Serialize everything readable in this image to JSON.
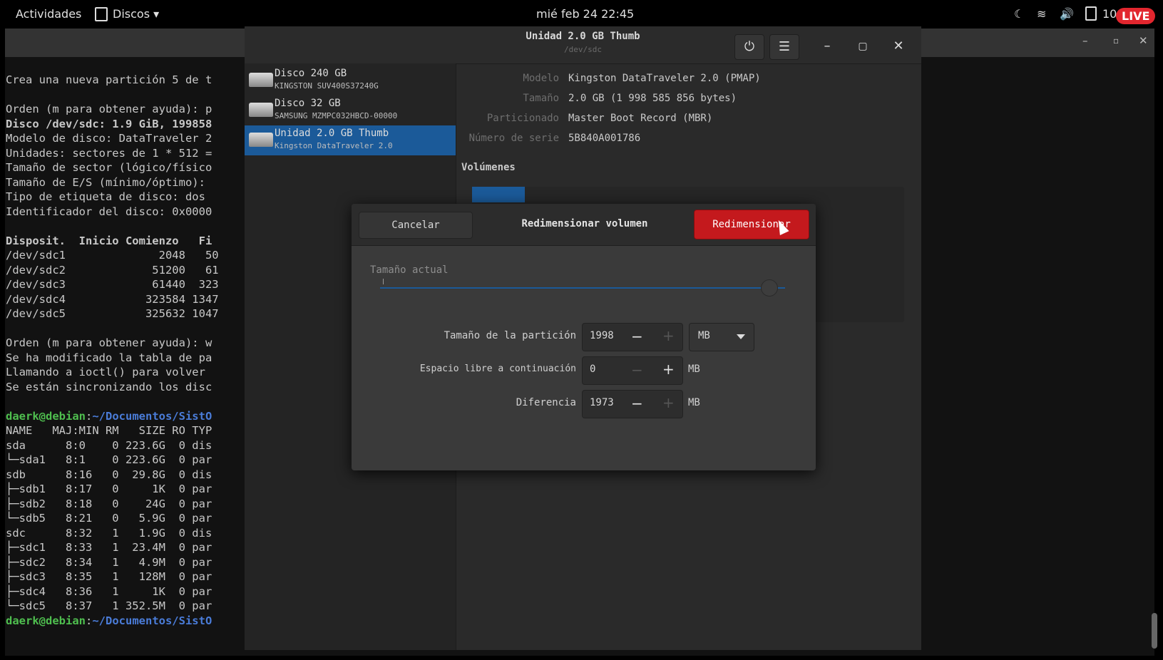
{
  "topbar": {
    "activities": "Actividades",
    "app_menu": "Discos ▾",
    "clock": "mié feb 24  22:45",
    "battery": "10",
    "live_badge": "LIVE"
  },
  "terminal": {
    "lines": [
      {
        "text": "Crea una nueva partición 5 de t",
        "style": ""
      },
      {
        "text": "",
        "style": ""
      },
      {
        "text": "Orden (m para obtener ayuda): p",
        "style": ""
      },
      {
        "text": "Disco /dev/sdc: 1.9 GiB, 199858",
        "style": "bold"
      },
      {
        "text": "Modelo de disco: DataTraveler 2",
        "style": ""
      },
      {
        "text": "Unidades: sectores de 1 * 512 =",
        "style": ""
      },
      {
        "text": "Tamaño de sector (lógico/físico",
        "style": ""
      },
      {
        "text": "Tamaño de E/S (mínimo/óptimo):",
        "style": ""
      },
      {
        "text": "Tipo de etiqueta de disco: dos",
        "style": ""
      },
      {
        "text": "Identificador del disco: 0x0000",
        "style": ""
      },
      {
        "text": "",
        "style": ""
      },
      {
        "text": "Disposit.  Inicio Comienzo   Fi",
        "style": "bold"
      },
      {
        "text": "/dev/sdc1              2048   50",
        "style": ""
      },
      {
        "text": "/dev/sdc2             51200   61",
        "style": ""
      },
      {
        "text": "/dev/sdc3             61440  323",
        "style": ""
      },
      {
        "text": "/dev/sdc4            323584 1347",
        "style": ""
      },
      {
        "text": "/dev/sdc5            325632 1047",
        "style": ""
      },
      {
        "text": "",
        "style": ""
      },
      {
        "text": "Orden (m para obtener ayuda): w",
        "style": ""
      },
      {
        "text": "Se ha modificado la tabla de pa",
        "style": ""
      },
      {
        "text": "Llamando a ioctl() para volver",
        "style": ""
      },
      {
        "text": "Se están sincronizando los disc",
        "style": ""
      },
      {
        "text": "",
        "style": ""
      },
      {
        "text": "daerk@debian:~/Documentos/SistO",
        "style": "prompt"
      },
      {
        "text": "NAME   MAJ:MIN RM   SIZE RO TYP",
        "style": ""
      },
      {
        "text": "sda      8:0    0 223.6G  0 dis",
        "style": ""
      },
      {
        "text": "└─sda1   8:1    0 223.6G  0 par",
        "style": ""
      },
      {
        "text": "sdb      8:16   0  29.8G  0 dis",
        "style": ""
      },
      {
        "text": "├─sdb1   8:17   0     1K  0 par",
        "style": ""
      },
      {
        "text": "├─sdb2   8:18   0    24G  0 par",
        "style": ""
      },
      {
        "text": "└─sdb5   8:21   0   5.9G  0 par",
        "style": ""
      },
      {
        "text": "sdc      8:32   1   1.9G  0 dis",
        "style": ""
      },
      {
        "text": "├─sdc1   8:33   1  23.4M  0 par",
        "style": ""
      },
      {
        "text": "├─sdc2   8:34   1   4.9M  0 par",
        "style": ""
      },
      {
        "text": "├─sdc3   8:35   1   128M  0 par",
        "style": ""
      },
      {
        "text": "├─sdc4   8:36   1     1K  0 par",
        "style": ""
      },
      {
        "text": "└─sdc5   8:37   1 352.5M  0 par",
        "style": ""
      },
      {
        "text": "daerk@debian:~/Documentos/SistO",
        "style": "prompt"
      }
    ]
  },
  "disks_window": {
    "title": "Unidad 2.0 GB Thumb",
    "subtitle": "/dev/sdc",
    "disk_list": [
      {
        "name": "Disco 240 GB",
        "sub": "KINGSTON SUV400S37240G",
        "selected": false
      },
      {
        "name": "Disco 32 GB",
        "sub": "SAMSUNG MZMPC032HBCD-00000",
        "selected": false
      },
      {
        "name": "Unidad 2.0 GB Thumb",
        "sub": "Kingston DataTraveler 2.0",
        "selected": true
      }
    ],
    "properties": [
      {
        "label": "Modelo",
        "value": "Kingston DataTraveler 2.0 (PMAP)"
      },
      {
        "label": "Tamaño",
        "value": "2.0 GB (1 998 585 856 bytes)"
      },
      {
        "label": "Particionado",
        "value": "Master Boot Record (MBR)"
      },
      {
        "label": "Número de serie",
        "value": "5B840A001786"
      }
    ],
    "volumes_title": "Volúmenes"
  },
  "dialog": {
    "cancel_label": "Cancelar",
    "title": "Redimensionar volumen",
    "resize_label": "Redimensionar",
    "slider_label": "Tamaño actual",
    "slider_fraction": 0.96,
    "rows": [
      {
        "label": "Tamaño de la partición",
        "value": "1998",
        "unit": "MB",
        "minus_enabled": true,
        "plus_enabled": false
      },
      {
        "label": "Espacio libre a continuación",
        "value": "0",
        "unit": "MB",
        "minus_enabled": false,
        "plus_enabled": true
      },
      {
        "label": "Diferencia",
        "value": "1973",
        "unit": "MB",
        "minus_enabled": true,
        "plus_enabled": false
      }
    ]
  }
}
